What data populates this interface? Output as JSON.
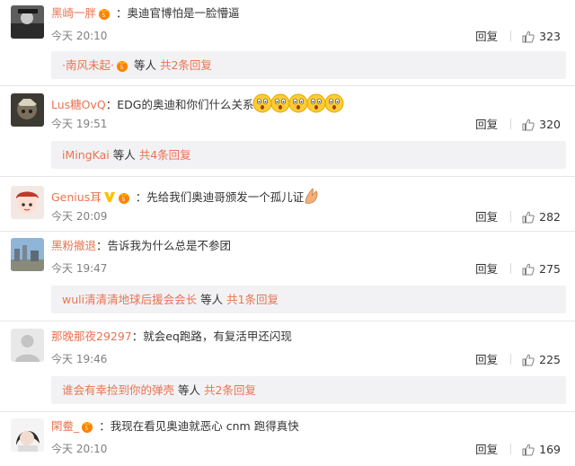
{
  "comments": [
    {
      "user": "黑崎一胖",
      "text": "奥迪官博怕是一脸懵逼",
      "time": "今天 20:10",
      "reply_label": "回复",
      "likes": "323",
      "sub": {
        "who": "·南风未起·",
        "etc": "等人",
        "more": "共2条回复"
      }
    },
    {
      "user": "Lus糖OvQ",
      "text": "EDG的奥迪和你们什么关系",
      "time": "今天 19:51",
      "reply_label": "回复",
      "likes": "320",
      "sub": {
        "who": "iMingKai",
        "etc": "等人",
        "more": "共4条回复"
      }
    },
    {
      "user": "Genius耳",
      "text": "先给我们奥迪哥颁发一个孤儿证",
      "time": "今天 20:09",
      "reply_label": "回复",
      "likes": "282"
    },
    {
      "user": "黑粉撤退",
      "text": "告诉我为什么总是不参团",
      "time": "今天 19:47",
      "reply_label": "回复",
      "likes": "275",
      "sub": {
        "who": "wuli清清清地球后援会会长",
        "etc": "等人",
        "more": "共1条回复"
      }
    },
    {
      "user": "那晚那夜29297",
      "text": "就会eq跑路，有复活甲还闪现",
      "time": "今天 19:46",
      "reply_label": "回复",
      "likes": "225",
      "sub": {
        "who": "谁会有幸捡到你的弹壳",
        "etc": "等人",
        "more": "共2条回复"
      }
    },
    {
      "user": "閑鲞_",
      "text": "我现在看见奥迪就恶心 cnm 跑得真快",
      "time": "今天 20:10",
      "reply_label": "回复",
      "likes": "169"
    }
  ],
  "colors": {
    "username": "#eb7350",
    "text": "#333333",
    "time": "#808080",
    "subbox_bg": "#f2f2f5",
    "vip_badge": "#ff8200"
  },
  "icons": {
    "like": "thumbs-up-icon",
    "vip": "vip-crown-badge",
    "verified": "verified-v-icon",
    "emoji_surprised": "surprised-emoji",
    "emoji_pray": "pray-hands-emoji"
  }
}
